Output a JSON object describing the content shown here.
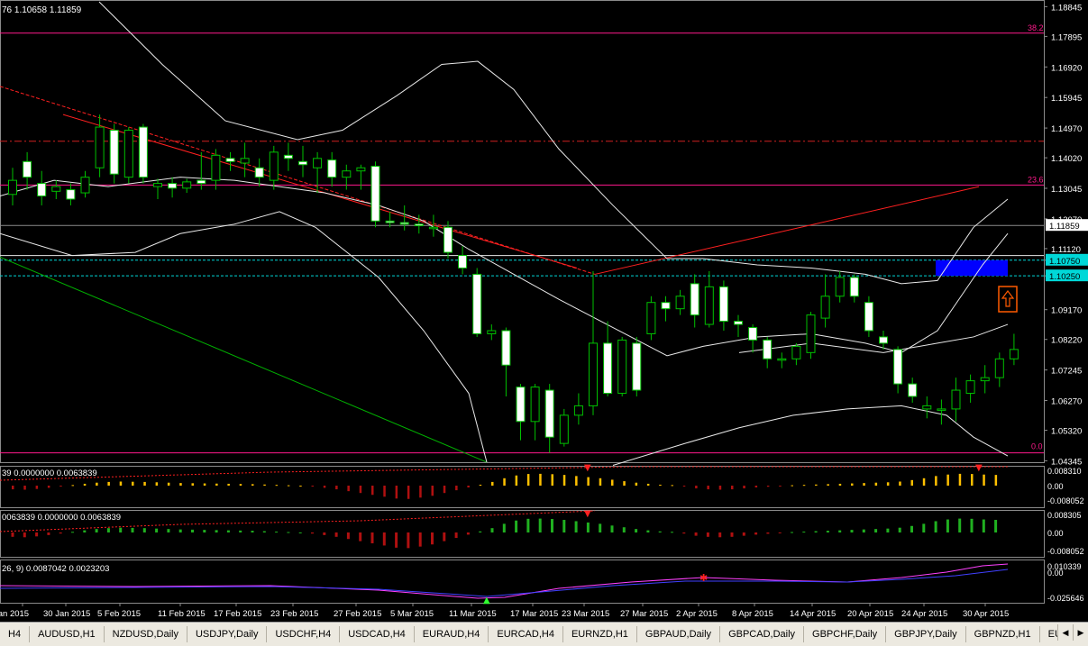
{
  "chart_data": [
    {
      "type": "candlestick",
      "symbol_header": "76 1.10658 1.11859",
      "y_ticks": [
        "1.18845",
        "1.17895",
        "1.16920",
        "1.15945",
        "1.14970",
        "1.14020",
        "1.13045",
        "1.12070",
        "1.11120",
        "1.10750",
        "1.10250",
        "1.09170",
        "1.08220",
        "1.07245",
        "1.06270",
        "1.05320",
        "1.04345"
      ],
      "current_price": "1.11859",
      "x_labels": [
        "Jan 2015",
        "30 Jan 2015",
        "5 Feb 2015",
        "11 Feb 2015",
        "17 Feb 2015",
        "23 Feb 2015",
        "27 Feb 2015",
        "5 Mar 2015",
        "11 Mar 2015",
        "17 Mar 2015",
        "23 Mar 2015",
        "27 Mar 2015",
        "2 Apr 2015",
        "8 Apr 2015",
        "14 Apr 2015",
        "20 Apr 2015",
        "24 Apr 2015",
        "30 Apr 2015"
      ],
      "fib_labels": {
        "top": "38.2",
        "mid": "23.6",
        "bottom": "0.0"
      },
      "candles": [
        [
          1.1285,
          1.133,
          1.125,
          1.137
        ],
        [
          1.139,
          1.134,
          1.13,
          1.142
        ],
        [
          1.132,
          1.128,
          1.125,
          1.136
        ],
        [
          1.1295,
          1.131,
          1.127,
          1.133
        ],
        [
          1.13,
          1.127,
          1.125,
          1.132
        ],
        [
          1.129,
          1.134,
          1.1275,
          1.136
        ],
        [
          1.137,
          1.15,
          1.134,
          1.154
        ],
        [
          1.149,
          1.135,
          1.132,
          1.151
        ],
        [
          1.134,
          1.149,
          1.132,
          1.15
        ],
        [
          1.15,
          1.134,
          1.132,
          1.151
        ],
        [
          1.131,
          1.132,
          1.127,
          1.1335
        ],
        [
          1.132,
          1.1305,
          1.1275,
          1.134
        ],
        [
          1.1305,
          1.1325,
          1.129,
          1.1335
        ],
        [
          1.133,
          1.132,
          1.13,
          1.142
        ],
        [
          1.133,
          1.141,
          1.13,
          1.143
        ],
        [
          1.14,
          1.139,
          1.136,
          1.142
        ],
        [
          1.1385,
          1.14,
          1.134,
          1.145
        ],
        [
          1.137,
          1.134,
          1.131,
          1.14
        ],
        [
          1.133,
          1.142,
          1.13,
          1.144
        ],
        [
          1.141,
          1.14,
          1.136,
          1.145
        ],
        [
          1.139,
          1.138,
          1.134,
          1.144
        ],
        [
          1.137,
          1.14,
          1.129,
          1.142
        ],
        [
          1.1395,
          1.134,
          1.131,
          1.142
        ],
        [
          1.134,
          1.136,
          1.13,
          1.138
        ],
        [
          1.136,
          1.137,
          1.13,
          1.138
        ],
        [
          1.1375,
          1.12,
          1.118,
          1.139
        ],
        [
          1.12,
          1.1195,
          1.118,
          1.123
        ],
        [
          1.1195,
          1.119,
          1.117,
          1.125
        ],
        [
          1.119,
          1.1185,
          1.116,
          1.122
        ],
        [
          1.118,
          1.118,
          1.115,
          1.122
        ],
        [
          1.118,
          1.11,
          1.108,
          1.12
        ],
        [
          1.109,
          1.105,
          1.103,
          1.112
        ],
        [
          1.103,
          1.084,
          1.083,
          1.105
        ],
        [
          1.084,
          1.085,
          1.082,
          1.087
        ],
        [
          1.085,
          1.074,
          1.064,
          1.086
        ],
        [
          1.067,
          1.056,
          1.05,
          1.068
        ],
        [
          1.056,
          1.067,
          1.05,
          1.068
        ],
        [
          1.066,
          1.051,
          1.046,
          1.068
        ],
        [
          1.049,
          1.058,
          1.048,
          1.06
        ],
        [
          1.058,
          1.061,
          1.055,
          1.065
        ],
        [
          1.061,
          1.081,
          1.058,
          1.104
        ],
        [
          1.081,
          1.065,
          1.064,
          1.088
        ],
        [
          1.065,
          1.082,
          1.064,
          1.083
        ],
        [
          1.081,
          1.066,
          1.064,
          1.083
        ],
        [
          1.084,
          1.094,
          1.082,
          1.096
        ],
        [
          1.094,
          1.092,
          1.088,
          1.096
        ],
        [
          1.092,
          1.096,
          1.09,
          1.098
        ],
        [
          1.1,
          1.09,
          1.086,
          1.103
        ],
        [
          1.087,
          1.099,
          1.086,
          1.104
        ],
        [
          1.099,
          1.088,
          1.085,
          1.101
        ],
        [
          1.088,
          1.087,
          1.083,
          1.09
        ],
        [
          1.086,
          1.082,
          1.078,
          1.087
        ],
        [
          1.082,
          1.076,
          1.073,
          1.083
        ],
        [
          1.076,
          1.076,
          1.073,
          1.078
        ],
        [
          1.076,
          1.08,
          1.074,
          1.081
        ],
        [
          1.078,
          1.09,
          1.076,
          1.091
        ],
        [
          1.089,
          1.096,
          1.086,
          1.103
        ],
        [
          1.096,
          1.102,
          1.094,
          1.104
        ],
        [
          1.102,
          1.096,
          1.094,
          1.103
        ],
        [
          1.094,
          1.085,
          1.083,
          1.096
        ],
        [
          1.083,
          1.081,
          1.079,
          1.085
        ],
        [
          1.079,
          1.068,
          1.065,
          1.08
        ],
        [
          1.068,
          1.064,
          1.062,
          1.07
        ],
        [
          1.06,
          1.061,
          1.057,
          1.064
        ],
        [
          1.06,
          1.06,
          1.055,
          1.063
        ],
        [
          1.06,
          1.066,
          1.056,
          1.07
        ],
        [
          1.065,
          1.069,
          1.062,
          1.071
        ],
        [
          1.069,
          1.07,
          1.065,
          1.074
        ],
        [
          1.07,
          1.076,
          1.067,
          1.078
        ],
        [
          1.076,
          1.079,
          1.074,
          1.084
        ],
        [
          1.08,
          1.079,
          1.076,
          1.085
        ],
        [
          1.082,
          1.076,
          1.074,
          1.084
        ],
        [
          1.076,
          1.076,
          1.07,
          1.079
        ],
        [
          1.075,
          1.074,
          1.073,
          1.076
        ],
        [
          1.074,
          1.075,
          1.072,
          1.08
        ],
        [
          1.076,
          1.081,
          1.069,
          1.084
        ],
        [
          1.081,
          1.086,
          1.08,
          1.089
        ],
        [
          1.086,
          1.088,
          1.084,
          1.091
        ],
        [
          1.088,
          1.091,
          1.085,
          1.093
        ],
        [
          1.091,
          1.096,
          1.089,
          1.101
        ],
        [
          1.096,
          1.106,
          1.094,
          1.111
        ],
        [
          1.106,
          1.118,
          1.104,
          1.122
        ],
        [
          1.12,
          1.129,
          1.118,
          1.13
        ],
        [
          1.123,
          1.12,
          1.118,
          1.127
        ],
        [
          1.12,
          1.116,
          1.113,
          1.122
        ],
        [
          1.116,
          1.1185,
          1.108,
          1.12
        ]
      ],
      "indicator_1": {
        "label": "39 0.0000000 0.0063839",
        "y_ticks": [
          "0.008310",
          "0.00",
          "-0.008052"
        ]
      },
      "indicator_2": {
        "label": "0063839 0.0000000 0.0063839",
        "y_ticks": [
          "0.008305",
          "0.00",
          "-0.008052"
        ]
      },
      "indicator_3": {
        "label": "26, 9) 0.0087042 0.0023203",
        "y_ticks": [
          "0.010339",
          "0.00",
          "-0.025646"
        ]
      },
      "hist_values": [
        -0.002,
        -0.0022,
        -0.0018,
        -0.0012,
        -0.0005,
        0.0003,
        0.001,
        0.0016,
        0.002,
        0.0022,
        0.0021,
        0.002,
        0.0018,
        0.0016,
        0.0014,
        0.0013,
        0.0012,
        0.0011,
        0.001,
        0.0009,
        0.0008,
        0.0006,
        0.0004,
        0.0002,
        0.0,
        -0.0005,
        -0.0012,
        -0.002,
        -0.003,
        -0.004,
        -0.005,
        -0.006,
        -0.007,
        -0.0072,
        -0.0065,
        -0.0055,
        -0.004,
        -0.0025,
        -0.001,
        0.0005,
        0.002,
        0.004,
        0.0055,
        0.0063,
        0.0064,
        0.0062,
        0.0058,
        0.0052,
        0.0046,
        0.004,
        0.0032,
        0.0024,
        0.0016,
        0.001,
        0.0005,
        0.0003,
        -0.0005,
        -0.0015,
        -0.002,
        -0.0022,
        -0.002,
        -0.0015,
        -0.001,
        -0.0006,
        -0.0002,
        0.0002,
        0.0004,
        0.0006,
        0.0008,
        0.001,
        0.0012,
        0.0014,
        0.0016,
        0.0018,
        0.0022,
        0.003,
        0.004,
        0.0052,
        0.006,
        0.0064,
        0.0063,
        0.006,
        0.0058
      ]
    }
  ],
  "tabs": [
    "H4",
    "AUDUSD,H1",
    "NZDUSD,Daily",
    "USDJPY,Daily",
    "USDCHF,H4",
    "USDCAD,H4",
    "EURAUD,H4",
    "EURCAD,H4",
    "EURNZD,H1",
    "GBPAUD,Daily",
    "GBPCAD,Daily",
    "GBPCHF,Daily",
    "GBPJPY,Daily",
    "GBPNZD,H1",
    "EURJPY,H"
  ],
  "colors": {
    "background": "#000000",
    "grid": "#3a3a3a",
    "bull_candle": "#000000",
    "bear_candle": "#ffffff",
    "wick": "#00c000",
    "fib": "#ff1a8c",
    "red_line": "#ff2020",
    "green_line": "#00b000",
    "price_box": "#ffffff",
    "cyan_box": "#00d8d8",
    "blue_zone": "#0000ff"
  }
}
